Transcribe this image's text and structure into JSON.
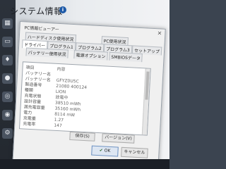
{
  "app": {
    "title": "システム情報",
    "info_icon": "i"
  },
  "rail": {
    "icons": [
      "grid-icon",
      "device-icon",
      "bell-icon",
      "pin-icon",
      "target-icon",
      "eye-icon"
    ]
  },
  "dialog": {
    "title": "PC情報ビューアー",
    "close": "×",
    "tabs_row1": [
      "ハードディスク使用状況",
      "PC使用状況"
    ],
    "tabs_row2": [
      "ドライバー",
      "プログラム1",
      "プログラム2",
      "プログラム3",
      "セットアップ"
    ],
    "tabs_row3": [
      "バッテリー使用状況",
      "電源オプション",
      "SMBIOSデータ"
    ],
    "rows": [
      {
        "k": "項目",
        "v": "内容"
      },
      {
        "k": "バッテリー名",
        "v": ""
      },
      {
        "k": "バッテリー名",
        "v": "GFYZ0U5C"
      },
      {
        "k": "製造番号",
        "v": "21080 400124"
      },
      {
        "k": "種類",
        "v": "LION"
      },
      {
        "k": "充電状態",
        "v": "放電中"
      },
      {
        "k": "設計容量",
        "v": "38510 mWh"
      },
      {
        "k": "満充電容量",
        "v": "35160 mWh"
      },
      {
        "k": "電力",
        "v": "8114 mW"
      },
      {
        "k": "充電量",
        "v": "1.27"
      },
      {
        "k": "充電率",
        "v": "147"
      }
    ],
    "buttons": {
      "save": "保存(S)",
      "version": "バージョン(V)",
      "ok": "OK",
      "cancel": "キャンセル"
    }
  }
}
